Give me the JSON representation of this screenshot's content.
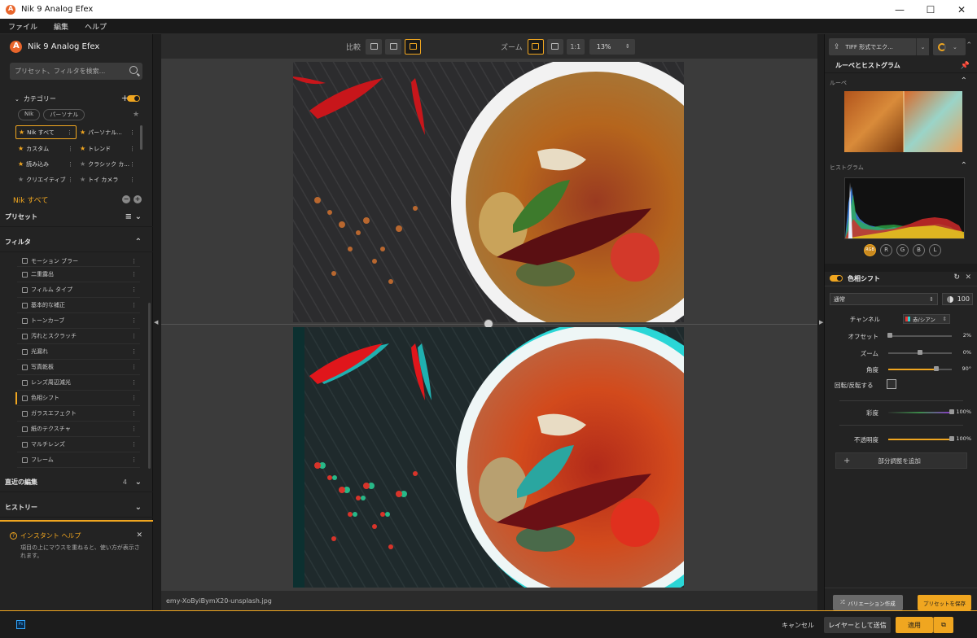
{
  "window": {
    "title": "Nik 9 Analog Efex",
    "minimize": "—",
    "maximize": "☐",
    "close": "✕"
  },
  "menubar": [
    "ファイル",
    "編集",
    "ヘルプ"
  ],
  "left": {
    "brand": "Nik 9 Analog Efex",
    "search_placeholder": "プリセット、フィルタを検索...",
    "category_title": "カテゴリー",
    "chips": [
      "Nik",
      "パーソナル"
    ],
    "categories": [
      {
        "label": "Nik すべて",
        "star": true
      },
      {
        "label": "パーソナル...",
        "star": true
      },
      {
        "label": "カスタム",
        "star": true
      },
      {
        "label": "トレンド",
        "star": true
      },
      {
        "label": "読み込み",
        "star": true
      },
      {
        "label": "クラシック カ...",
        "star": false
      },
      {
        "label": "クリエイティブ",
        "star": false
      },
      {
        "label": "トイ カメラ",
        "star": false
      }
    ],
    "current_group": "Nik すべて",
    "presets_title": "プリセット",
    "filters_title": "フィルタ",
    "filters": [
      "モーション ブラー",
      "二重露出",
      "フィルム タイプ",
      "基本的な補正",
      "トーンカーブ",
      "汚れとスクラッチ",
      "光漏れ",
      "写真乾板",
      "レンズ周辺減光",
      "色相シフト",
      "ガラスエフェクト",
      "紙のテクスチャ",
      "マルチレンズ",
      "フレーム"
    ],
    "active_filter": 9,
    "recent_title": "直近の編集",
    "recent_count": "4",
    "history_title": "ヒストリー",
    "help_title": "インスタント ヘルプ",
    "help_text": "項目の上にマウスを重ねると、使い方が表示されます。"
  },
  "toolbar": {
    "compare_label": "比較",
    "zoom_label": "ズーム",
    "one_to_one": "1:1",
    "zoom_value": "13%"
  },
  "canvas": {
    "filename": "emy-XoByiBymX20-unsplash.jpg"
  },
  "right": {
    "export_label": "TIFF 形式でエク...",
    "loupe_hist_title": "ルーペとヒストグラム",
    "loupe_label": "ルーペ",
    "histogram_label": "ヒストグラム",
    "channel_buttons": [
      "RGB",
      "R",
      "G",
      "B",
      "L"
    ],
    "filter_name": "色相シフト",
    "blend_mode": "通常",
    "opacity_value": "100",
    "params": {
      "channel_label": "チャンネル",
      "channel_value": "赤/シアン",
      "offset_label": "オフセット",
      "offset_value": "2%",
      "zoom_label": "ズーム",
      "zoom_value": "0%",
      "angle_label": "角度",
      "angle_value": "90°",
      "flip_label": "回転/反転する",
      "saturation_label": "彩度",
      "saturation_value": "100%",
      "opacity_label": "不透明度",
      "opacity_value": "100%"
    },
    "param_levels": {
      "offset": 0.02,
      "zoom": 0.5,
      "angle": 0.75,
      "saturation": 1.0,
      "opacity": 1.0
    },
    "add_adjust": "部分調整を追加",
    "variation_button": "バリエーション作成",
    "save_preset_button": "プリセットを保存"
  },
  "bottom": {
    "ps_badge": "Ps",
    "cancel": "キャンセル",
    "send_as_layer": "レイヤーとして送信",
    "apply": "適用"
  },
  "colors": {
    "accent": "#f0a620",
    "panel": "#232323",
    "canvas": "#3b3b3b"
  }
}
